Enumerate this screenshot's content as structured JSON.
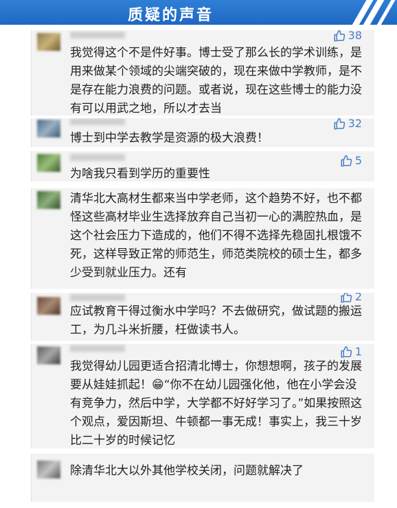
{
  "banner": {
    "title": "质疑的声音"
  },
  "colors": {
    "banner": "#1f68c2",
    "like_icon": "#4a7dc6",
    "card_bg": "#f3f3f3"
  },
  "comments": [
    {
      "likes": "38",
      "text": "我觉得这个不是件好事。博士受了那么长的学术训练，是用来做某个领域的尖端突破的，现在来做中学教师，是不是存在能力浪费的问题。或者说，现在这些博士的能力没有可以用武之地，所以才去当"
    },
    {
      "likes": "32",
      "text": "博士到中学去教学是资源的极大浪费！"
    },
    {
      "likes": "5",
      "text": "为啥我只看到学历的重要性"
    },
    {
      "likes": "",
      "text": "清华北大高材生都来当中学老师，这个趋势不好，也不都怪这些高材毕业生选择放弃自己当初一心的满腔热血，是这个社会压力下造成的，他们不得不选择先稳固扎根饿不死，这样导致正常的师范生，师范类院校的硕士生，都多少受到就业压力。还有"
    },
    {
      "likes": "2",
      "text": "应试教育干得过衡水中学吗？不去做研究，做试题的搬运工，为几斗米折腰，枉做读书人。"
    },
    {
      "likes": "1",
      "text": "我觉得幼儿园更适合招清北博士，你想想啊，孩子的发展要从娃娃抓起！😁“你不在幼儿园强化他，他在小学会没有竞争力，然后中学，大学都不好好学习了。”如果按照这个观点，爱因斯坦、牛顿都一事无成！事实上，我三十岁比二十岁的时候记忆"
    },
    {
      "likes": "",
      "text": "除清华北大以外其他学校关闭，问题就解决了"
    }
  ]
}
